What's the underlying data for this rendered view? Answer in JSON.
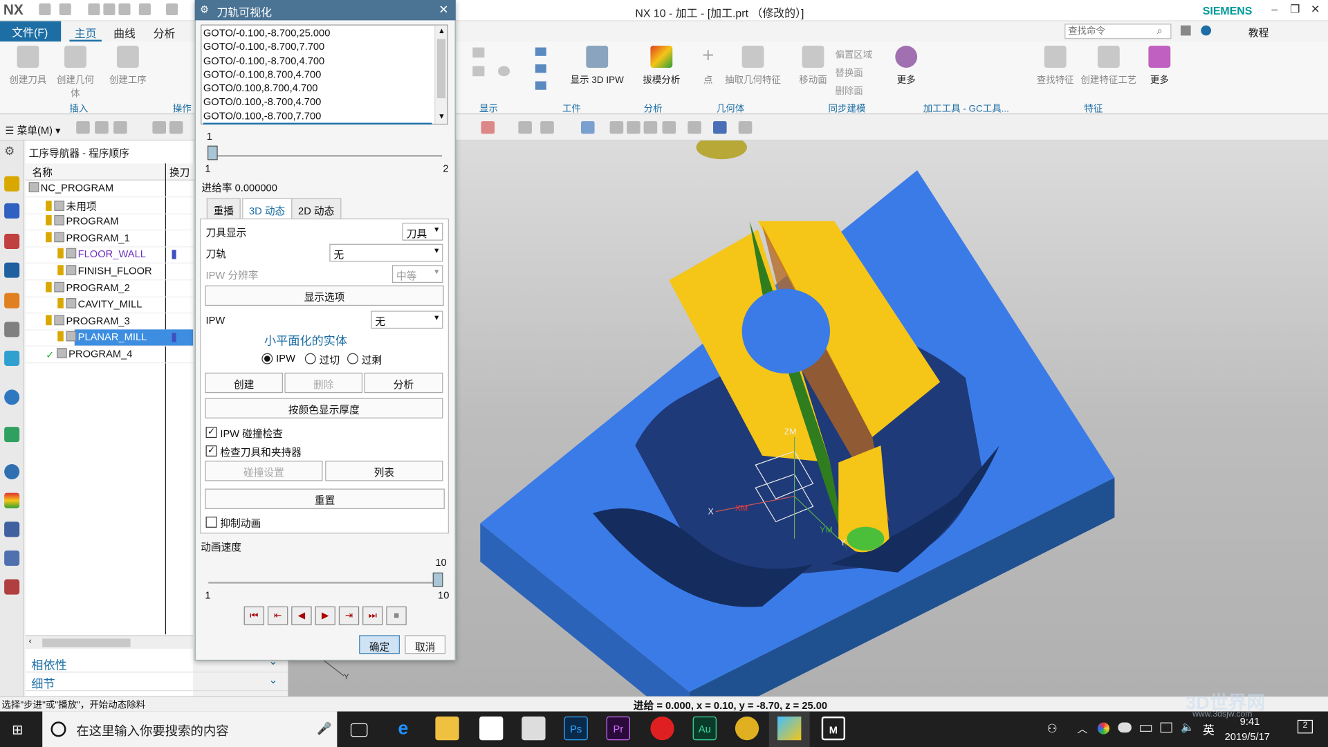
{
  "window": {
    "title": "NX 10 - 加工 - [加工.prt （修改的）]",
    "logo": "NX",
    "brand": "SIEMENS"
  },
  "menubar": {
    "file": "文件(F)",
    "tabs": [
      "主页",
      "曲线",
      "分析"
    ],
    "search_placeholder": "查找命令",
    "tutorial": "教程"
  },
  "ribbon": {
    "left_buttons": [
      "创建刀具",
      "创建几何体",
      "创建工序"
    ],
    "right_buttons": [
      "显示 3D IPW",
      "拔模分析",
      "点",
      "抽取几何特征",
      "移动面",
      "更多",
      "查找特征",
      "创建特征工艺",
      "更多"
    ],
    "sync_small": [
      "偏置区域",
      "替换面",
      "删除面"
    ],
    "groups": [
      "插入",
      "操作",
      "显示",
      "工件",
      "分析",
      "几何体",
      "同步建模",
      "加工工具 - GC工具...",
      "特征"
    ]
  },
  "toolbar": {
    "menu": "菜单(M)"
  },
  "navigator": {
    "title": "工序导航器 - 程序顺序",
    "col_name": "名称",
    "col_tool": "换刀",
    "rows": [
      {
        "label": "NC_PROGRAM",
        "indent": 0
      },
      {
        "label": "未用项",
        "indent": 1
      },
      {
        "label": "PROGRAM",
        "indent": 1
      },
      {
        "label": "PROGRAM_1",
        "indent": 1
      },
      {
        "label": "FLOOR_WALL",
        "indent": 2
      },
      {
        "label": "FINISH_FLOOR",
        "indent": 2
      },
      {
        "label": "PROGRAM_2",
        "indent": 1
      },
      {
        "label": "CAVITY_MILL",
        "indent": 2
      },
      {
        "label": "PROGRAM_3",
        "indent": 1
      },
      {
        "label": "PLANAR_MILL",
        "indent": 2
      },
      {
        "label": "PROGRAM_4",
        "indent": 1
      }
    ],
    "dependencies": "相依性",
    "details": "细节"
  },
  "dialog": {
    "title": "刀轨可视化",
    "goto_lines": [
      "GOTO/-0.100,-8.700,25.000",
      "GOTO/-0.100,-8.700,7.700",
      "GOTO/-0.100,-8.700,4.700",
      "GOTO/-0.100,8.700,4.700",
      "GOTO/0.100,8.700,4.700",
      "GOTO/0.100,-8.700,4.700",
      "GOTO/0.100,-8.700,7.700"
    ],
    "step_value": "1",
    "step_min": "1",
    "step_max": "2",
    "feed": "进给率 0.000000",
    "tabs": [
      "重播",
      "3D 动态",
      "2D 动态"
    ],
    "tool_display_label": "刀具显示",
    "tool_display_value": "刀具",
    "toolpath_label": "刀轨",
    "toolpath_value": "无",
    "ipw_res_label": "IPW 分辨率",
    "ipw_res_value": "中等",
    "display_options": "显示选项",
    "ipw_label": "IPW",
    "ipw_value": "无",
    "faceted": "小平面化的实体",
    "radios": [
      "IPW",
      "过切",
      "过剩"
    ],
    "create": "创建",
    "delete": "删除",
    "analyze": "分析",
    "thickness": "按颜色显示厚度",
    "check1": "IPW 碰撞检查",
    "check2": "检查刀具和夹持器",
    "collision_settings": "碰撞设置",
    "list": "列表",
    "reset": "重置",
    "suppress": "抑制动画",
    "speed_label": "动画速度",
    "speed_value": "10",
    "speed_min": "1",
    "speed_max": "10",
    "ok": "确定",
    "cancel": "取消"
  },
  "viewport": {
    "axis_zm": "ZM",
    "axis_xm": "XM",
    "axis_ym": "YM",
    "axis_x": "X",
    "axis_y": "Y"
  },
  "status": {
    "left": "选择\"步进\"或\"播放\"，开始动态除料",
    "right": "进给 = 0.000, x = 0.10, y = -8.70, z = 25.00"
  },
  "taskbar": {
    "search": "在这里输入你要搜索的内容",
    "time": "9:41",
    "date": "2019/5/17",
    "ime": "英",
    "notify": "2",
    "watermark": "3D世界网",
    "watermark_url": "www.3dsjw.com"
  },
  "colors": {
    "accent": "#1c6ea4",
    "block": "#3b7be8",
    "part": "#f5c518",
    "green": "#2f7d1e"
  }
}
